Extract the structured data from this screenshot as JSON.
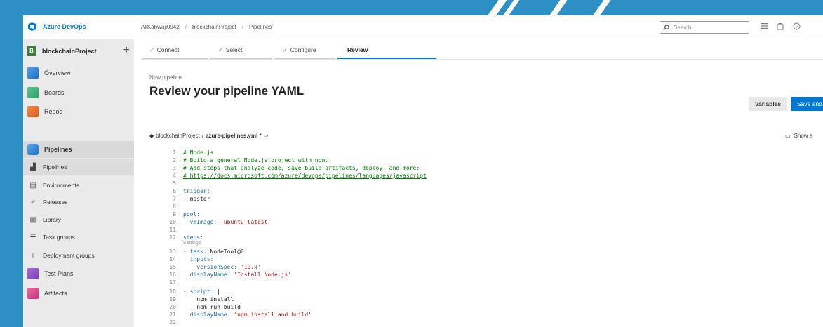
{
  "header": {
    "brand": "Azure DevOps",
    "breadcrumb": [
      "AliKahwaji0942",
      "blockchainProject",
      "Pipelines"
    ],
    "breadcrumb_sep": "/",
    "search_placeholder": "Search"
  },
  "sidebar": {
    "project_badge": "B",
    "project_name": "blockchainProject",
    "add_label": "+",
    "items": [
      {
        "label": "Overview",
        "icon": "overview-icon",
        "color": "#1f6fc5"
      },
      {
        "label": "Boards",
        "icon": "boards-icon",
        "color": "#2f9e6a"
      },
      {
        "label": "Repos",
        "icon": "repos-icon",
        "color": "#e05a1e"
      },
      {
        "label": "Pipelines",
        "icon": "pipelines-icon",
        "color": "#1f6fc5"
      },
      {
        "label": "Pipelines",
        "icon": "pipelines-sub-icon"
      },
      {
        "label": "Environments",
        "icon": "environments-icon"
      },
      {
        "label": "Releases",
        "icon": "releases-icon"
      },
      {
        "label": "Library",
        "icon": "library-icon"
      },
      {
        "label": "Task groups",
        "icon": "task-groups-icon"
      },
      {
        "label": "Deployment groups",
        "icon": "deployment-groups-icon"
      },
      {
        "label": "Test Plans",
        "icon": "test-plans-icon",
        "color": "#7b3fb5"
      },
      {
        "label": "Artifacts",
        "icon": "artifacts-icon",
        "color": "#c8327a"
      }
    ]
  },
  "wizard": {
    "steps": [
      {
        "label": "Connect",
        "done": true
      },
      {
        "label": "Select",
        "done": true
      },
      {
        "label": "Configure",
        "done": true
      },
      {
        "label": "Review",
        "done": false
      }
    ],
    "check": "✓"
  },
  "page": {
    "subtitle": "New pipeline",
    "title": "Review your pipeline YAML",
    "variables_label": "Variables",
    "save_label": "Save and r",
    "file_repo": "blockchainProject",
    "file_sep": "/",
    "file_name": "azure-pipelines.yml *",
    "show_assistant": "Show a"
  },
  "editor": {
    "codelens": "Settings",
    "lines": [
      {
        "n": "1",
        "t": "# Node.js",
        "k": "comment"
      },
      {
        "n": "2",
        "t": "# Build a general Node.js project with npm.",
        "k": "comment"
      },
      {
        "n": "3",
        "t": "# Add steps that analyze code, save build artifacts, deploy, and more:",
        "k": "comment"
      },
      {
        "n": "4",
        "t": "# https://docs.microsoft.com/azure/devops/pipelines/languages/javascript",
        "k": "link"
      },
      {
        "n": "5",
        "t": "",
        "k": "plain"
      },
      {
        "n": "6",
        "t": "trigger:",
        "k": "key"
      },
      {
        "n": "7",
        "t": "- master",
        "k": "plain"
      },
      {
        "n": "8",
        "t": "",
        "k": "plain"
      },
      {
        "n": "9",
        "t": "pool:",
        "k": "key"
      },
      {
        "n": "10",
        "t": "  vmImage: 'ubuntu-latest'",
        "k": "mixed"
      },
      {
        "n": "11",
        "t": "",
        "k": "plain"
      },
      {
        "n": "12",
        "t": "steps:",
        "k": "key"
      },
      {
        "n": "13",
        "t": "- task: NodeTool@0",
        "k": "mixed"
      },
      {
        "n": "14",
        "t": "  inputs:",
        "k": "key"
      },
      {
        "n": "15",
        "t": "    versionSpec: '10.x'",
        "k": "mixed"
      },
      {
        "n": "16",
        "t": "  displayName: 'Install Node.js'",
        "k": "mixed"
      },
      {
        "n": "17",
        "t": "",
        "k": "plain"
      },
      {
        "n": "18",
        "t": "- script: |",
        "k": "mixed"
      },
      {
        "n": "19",
        "t": "    npm install",
        "k": "plain"
      },
      {
        "n": "20",
        "t": "    npm run build",
        "k": "plain"
      },
      {
        "n": "21",
        "t": "  displayName: 'npm install and build'",
        "k": "mixed"
      },
      {
        "n": "22",
        "t": "",
        "k": "plain"
      }
    ]
  },
  "colors": {
    "accent": "#0078d4",
    "background": "#2e8fc4"
  }
}
